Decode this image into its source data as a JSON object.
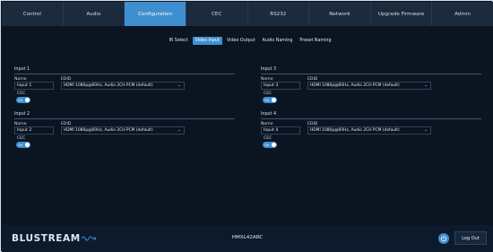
{
  "nav": {
    "tabs": [
      "Control",
      "Audio",
      "Configuration",
      "CEC",
      "RS232",
      "Network",
      "Upgrade Firmware",
      "Admin"
    ],
    "active": "Configuration"
  },
  "subtabs": {
    "items": [
      "IR Select",
      "Video Input",
      "Video Output",
      "Audio Naming",
      "Preset Naming"
    ],
    "active": "Video Input"
  },
  "labels": {
    "name": "Name",
    "edid": "EDID",
    "cec": "CEC",
    "toggle_on": "On"
  },
  "inputs": [
    {
      "title": "Input 1",
      "name_value": "Input 1",
      "edid_value": "HDMI 1080p@60Hz, Audio 2CH PCM (default)",
      "cec_on": true
    },
    {
      "title": "Input 2",
      "name_value": "Input 2",
      "edid_value": "HDMI 1080p@60Hz, Audio 2CH PCM (default)",
      "cec_on": true
    },
    {
      "title": "Input 3",
      "name_value": "Input 3",
      "edid_value": "HDMI 1080p@60Hz, Audio 2CH PCM (default)",
      "cec_on": true
    },
    {
      "title": "Input 4",
      "name_value": "Input 4",
      "edid_value": "HDMI 1080p@60Hz, Audio 2CH PCM (default)",
      "cec_on": true
    }
  ],
  "footer": {
    "logo_text": "BLUSTREAM",
    "model": "HMXL42ARC",
    "logout_label": "Log Out",
    "power_icon": "power-icon"
  },
  "colors": {
    "accent": "#3f8fd0",
    "background": "#0b1522",
    "nav": "#1b2a3d"
  }
}
